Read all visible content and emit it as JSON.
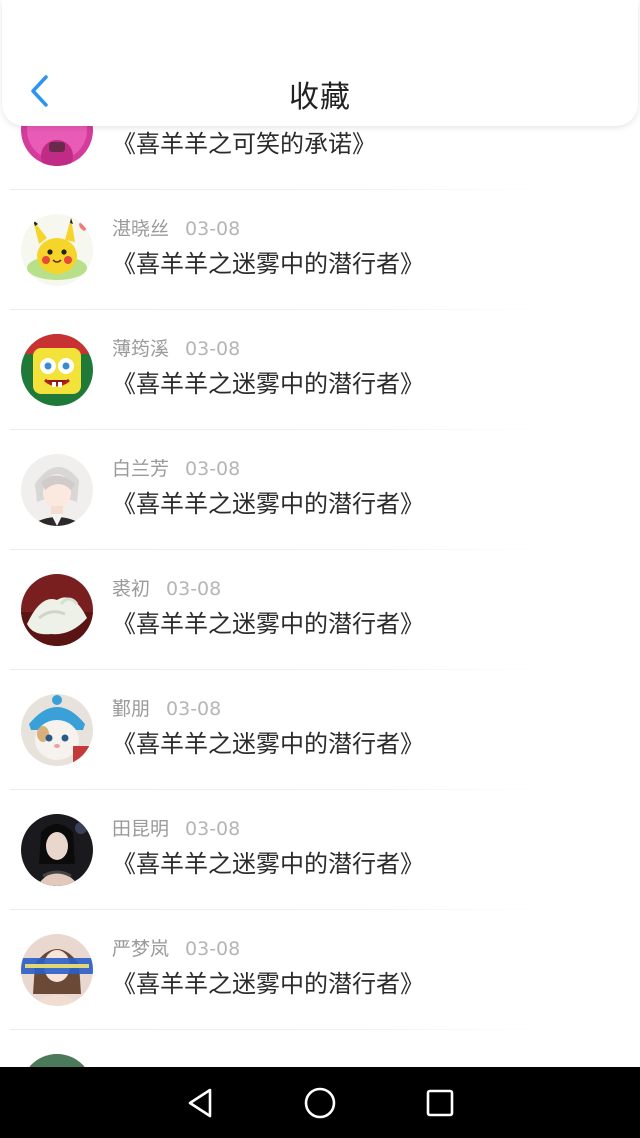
{
  "header": {
    "title": "收藏"
  },
  "items": [
    {
      "name": "",
      "date": "",
      "title": "《喜羊羊之可笑的承诺》",
      "avatar": "magenta-avatar"
    },
    {
      "name": "湛晓丝",
      "date": "03-08",
      "title": "《喜羊羊之迷雾中的潜行者》",
      "avatar": "pikachu-avatar"
    },
    {
      "name": "薄筠溪",
      "date": "03-08",
      "title": "《喜羊羊之迷雾中的潜行者》",
      "avatar": "spongebob-avatar"
    },
    {
      "name": "白兰芳",
      "date": "03-08",
      "title": "《喜羊羊之迷雾中的潜行者》",
      "avatar": "anime-boy-avatar"
    },
    {
      "name": "裘初",
      "date": "03-08",
      "title": "《喜羊羊之迷雾中的潜行者》",
      "avatar": "food-avatar"
    },
    {
      "name": "鄞朋",
      "date": "03-08",
      "title": "《喜羊羊之迷雾中的潜行者》",
      "avatar": "cat-avatar"
    },
    {
      "name": "田昆明",
      "date": "03-08",
      "title": "《喜羊羊之迷雾中的潜行者》",
      "avatar": "girl-dark-avatar"
    },
    {
      "name": "严梦岚",
      "date": "03-08",
      "title": "《喜羊羊之迷雾中的潜行者》",
      "avatar": "girl-light-avatar"
    },
    {
      "name": "",
      "date": "",
      "title": "",
      "avatar": "partial-avatar"
    }
  ],
  "navbar": {
    "icons": [
      "back-triangle-icon",
      "home-circle-icon",
      "recents-square-icon"
    ]
  },
  "colors": {
    "accent": "#2a95ee",
    "text": "#2b2b2b",
    "meta": "#9a9a9a"
  }
}
